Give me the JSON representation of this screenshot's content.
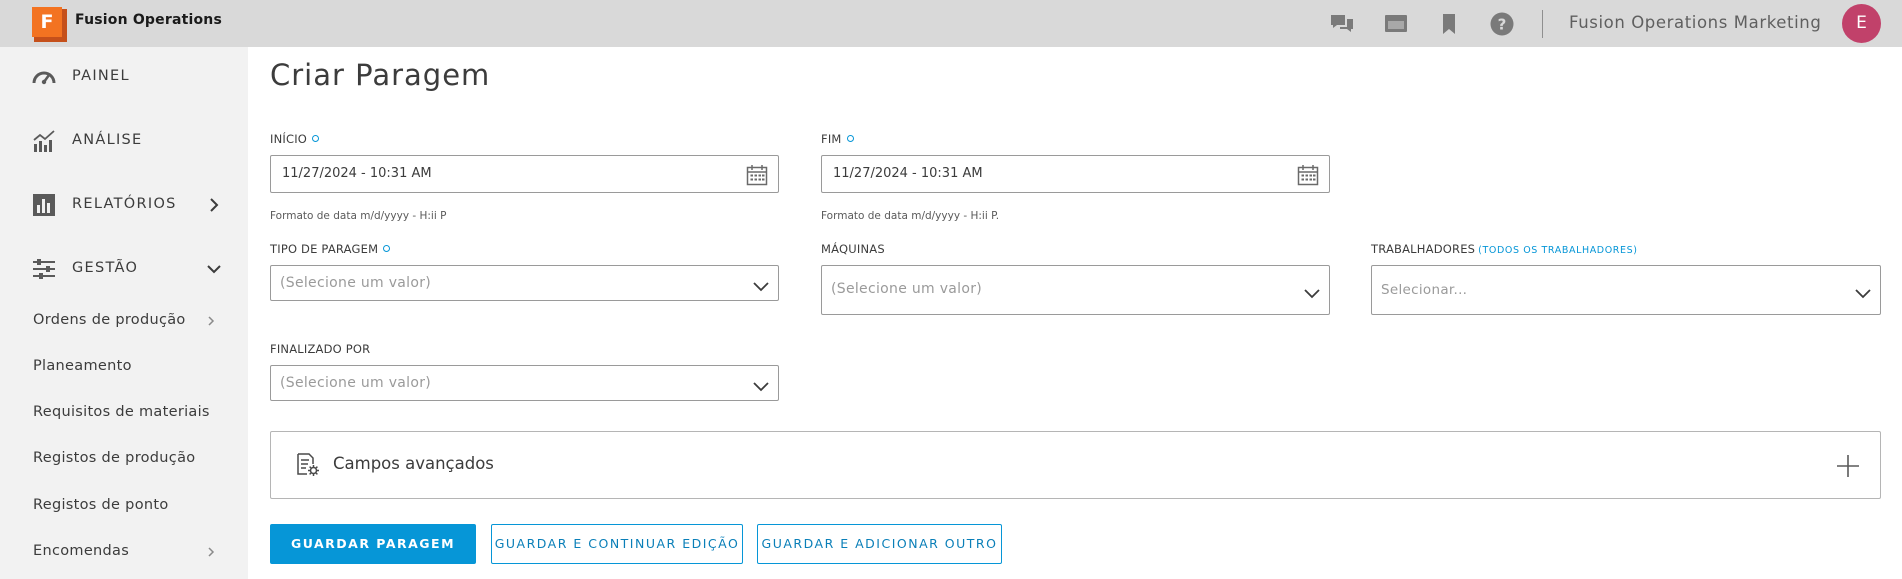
{
  "app": {
    "logo_letter": "F",
    "title": "Fusion Operations",
    "org_name": "Fusion Operations Marketing",
    "avatar_initial": "E"
  },
  "sidebar": {
    "main_items": [
      {
        "label": "PAINEL",
        "icon": "dashboard-icon"
      },
      {
        "label": "ANÁLISE",
        "icon": "analytics-icon"
      },
      {
        "label": "RELATÓRIOS",
        "icon": "reports-icon"
      },
      {
        "label": "GESTÃO",
        "icon": "management-icon"
      }
    ],
    "sub_items": [
      {
        "label": "Ordens de produção",
        "has_children": true
      },
      {
        "label": "Planeamento",
        "has_children": false
      },
      {
        "label": "Requisitos de materiais",
        "has_children": false
      },
      {
        "label": "Registos de produção",
        "has_children": false
      },
      {
        "label": "Registos de ponto",
        "has_children": false
      },
      {
        "label": "Encomendas",
        "has_children": true
      }
    ]
  },
  "form": {
    "title": "Criar Paragem",
    "start": {
      "label": "INÍCIO",
      "value": "11/27/2024 - 10:31 AM",
      "hint": "Formato de data m/d/yyyy - H:ii P"
    },
    "end": {
      "label": "FIM",
      "value": "11/27/2024 - 10:31 AM",
      "hint": "Formato de data m/d/yyyy - H:ii P."
    },
    "stop_type": {
      "label": "TIPO DE PARAGEM",
      "placeholder": "(Selecione um valor)"
    },
    "machines": {
      "label": "MÁQUINAS",
      "placeholder": "(Selecione um valor)"
    },
    "workers": {
      "label": "TRABALHADORES",
      "link": "(TODOS OS TRABALHADORES)",
      "placeholder": "Selecionar..."
    },
    "finished_by": {
      "label": "FINALIZADO POR",
      "placeholder": "(Selecione um valor)"
    },
    "advanced": {
      "label": "Campos avançados"
    }
  },
  "buttons": {
    "save": "GUARDAR PARAGEM",
    "save_continue": "GUARDAR E CONTINUAR EDIÇÃO",
    "save_add": "GUARDAR E ADICIONAR OUTRO"
  },
  "colors": {
    "accent": "#0696d7",
    "logo": "#f37321",
    "avatar": "#c1416a",
    "topbar": "#d9d9d9",
    "sidebar": "#f2f2f2"
  }
}
